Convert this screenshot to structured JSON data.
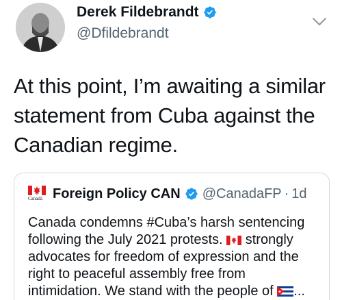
{
  "author": {
    "name": "Derek Fildebrandt",
    "handle": "@Dfildebrandt"
  },
  "tweet": {
    "text": "At this point, I’m awaiting a similar statement from Cuba against the Canadian regime."
  },
  "quoted_tweet": {
    "logo_caption": "Canadä",
    "name": "Foreign Policy CAN",
    "handle": "@CanadaFP",
    "separator": "·",
    "time": "1d",
    "body_part1": "Canada condemns #Cuba’s harsh sentencing following the July 2021 protests.",
    "body_part2": "strongly advocates for freedom of expression and the right to peaceful assembly free from intimidation. We stand with the people of",
    "ellipsis": "..."
  },
  "icons": {
    "verified": "verified-badge-icon",
    "caret": "chevron-down-icon",
    "canada_flag": "canada-flag-icon",
    "cuba_flag": "cuba-flag-icon"
  },
  "colors": {
    "verified_blue": "#1d9bf0",
    "text": "#0f1419",
    "secondary": "#536471",
    "border": "#cfd9de",
    "canada_red": "#e01b22",
    "cuba_blue": "#0b3d91"
  }
}
